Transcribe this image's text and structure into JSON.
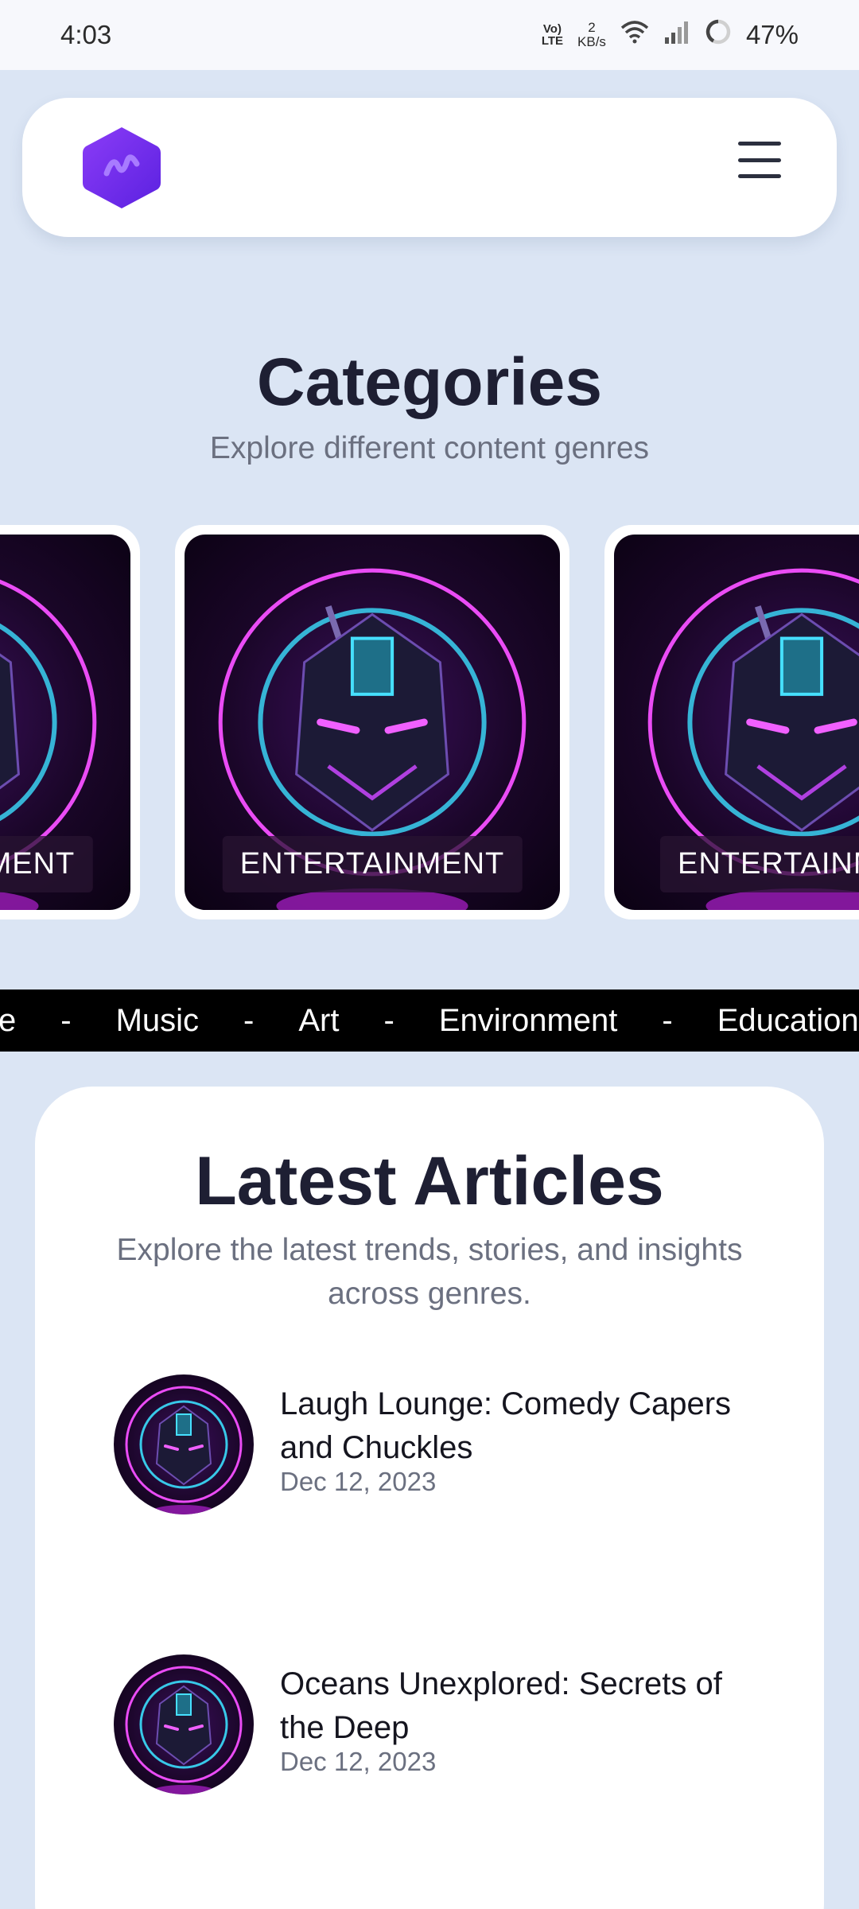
{
  "status_bar": {
    "time": "4:03",
    "volte": "Vo) LTE",
    "speed_value": "2",
    "speed_unit": "KB/s",
    "battery": "47%"
  },
  "header": {
    "logo_icon": "hexagon-pulse-logo",
    "menu_icon": "hamburger-menu-icon"
  },
  "categories": {
    "title": "Categories",
    "subtitle": "Explore different content genres",
    "items": [
      {
        "label": "ENTERTAINMENT"
      },
      {
        "label": "ENTERTAINMENT"
      },
      {
        "label": "ENTERTAINMENT"
      }
    ]
  },
  "ticker": {
    "items": [
      "e",
      "Music",
      "Art",
      "Environment",
      "Education"
    ],
    "separator": "-"
  },
  "articles": {
    "title": "Latest Articles",
    "subtitle": "Explore the latest trends, stories, and insights across genres.",
    "items": [
      {
        "title": "Laugh Lounge: Comedy Capers and Chuckles",
        "date": "Dec 12, 2023"
      },
      {
        "title": "Oceans Unexplored: Secrets of the Deep",
        "date": "Dec 12, 2023"
      }
    ]
  },
  "colors": {
    "page_bg": "#dbe5f4",
    "logo_purple": "#6b2ff0",
    "neon_magenta": "#e040fb",
    "neon_cyan": "#40d8f0"
  }
}
